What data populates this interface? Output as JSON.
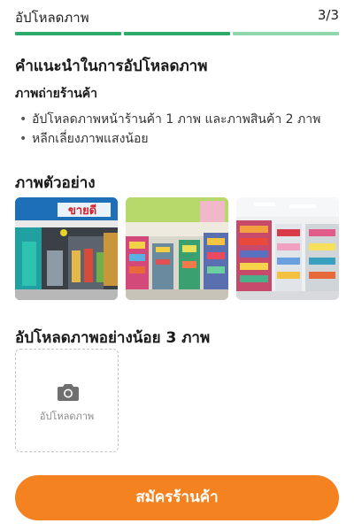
{
  "header": {
    "title": "อัปโหลดภาพ",
    "step": "3/3"
  },
  "progress": {
    "segments": 3,
    "active_color": "#2dab6a",
    "inactive_color": "#8fd7ad",
    "current": 3
  },
  "guide": {
    "title": "คำแนะนำในการอัปโหลดภาพ",
    "subtitle": "ภาพถ่ายร้านค้า",
    "items": [
      "อัปโหลดภาพหน้าร้านค้า 1 ภาพ และภาพสินค้า 2 ภาพ",
      "หลีกเลี่ยงภาพแสงน้อย"
    ]
  },
  "examples": {
    "title": "ภาพตัวอย่าง",
    "images": [
      {
        "name": "storefront-photo",
        "sign_text": "ขายดี"
      },
      {
        "name": "store-interior-photo-1"
      },
      {
        "name": "store-interior-photo-2"
      }
    ]
  },
  "upload": {
    "title": "อัปโหลดภาพอย่างน้อย 3 ภาพ",
    "box_label": "อัปโหลดภาพ",
    "icon": "camera-icon"
  },
  "submit": {
    "label": "สมัครร้านค้า",
    "color": "#f58220"
  }
}
